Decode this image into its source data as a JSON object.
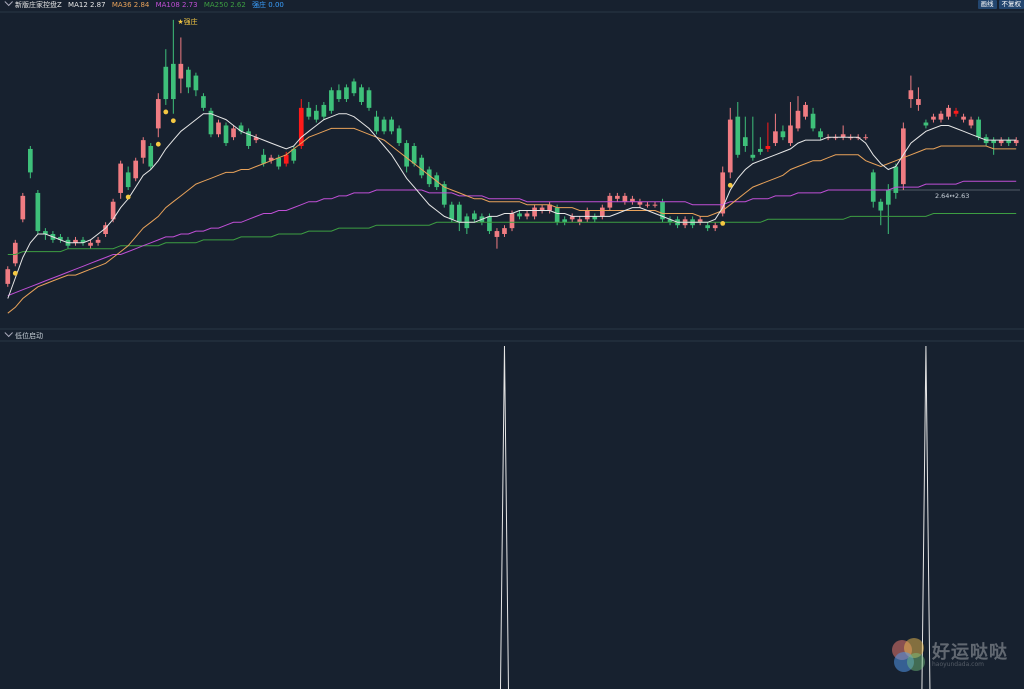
{
  "header": {
    "indicator_name": "新版庄家控盘Z",
    "ma12": "MA12 2.87",
    "ma36": "MA36 2.84",
    "ma108": "MA108 2.73",
    "ma250": "MA250 2.62",
    "strong": "强庄 0.00",
    "btn_draw": "画线",
    "btn_fq": "不复权"
  },
  "sub_panel": {
    "title": "低位启动"
  },
  "watermark": {
    "title": "好运哒哒",
    "sub": "haoyundada.com"
  },
  "colors": {
    "bg": "#17212f",
    "up": "#f07c82",
    "up_big": "#ff1a1a",
    "down": "#3ec07a",
    "ma12": "#e6e6e6",
    "ma36": "#e8a25a",
    "ma108": "#c04fd6",
    "ma250": "#3d9e42",
    "strong": "#3aa0ff"
  },
  "chart_data": {
    "type": "candlestick",
    "ylim": [
      2.25,
      3.3
    ],
    "candles": [
      [
        2.38,
        2.43,
        2.37,
        2.44
      ],
      [
        2.45,
        2.52,
        2.44,
        2.53
      ],
      [
        2.6,
        2.68,
        2.59,
        2.69
      ],
      [
        2.84,
        2.76,
        2.74,
        2.85
      ],
      [
        2.69,
        2.56,
        2.55,
        2.7
      ],
      [
        2.56,
        2.55,
        2.53,
        2.57
      ],
      [
        2.55,
        2.53,
        2.52,
        2.56
      ],
      [
        2.54,
        2.53,
        2.52,
        2.55
      ],
      [
        2.53,
        2.51,
        2.5,
        2.54
      ],
      [
        2.52,
        2.53,
        2.51,
        2.54
      ],
      [
        2.53,
        2.52,
        2.51,
        2.54
      ],
      [
        2.51,
        2.52,
        2.5,
        2.53
      ],
      [
        2.52,
        2.53,
        2.51,
        2.54
      ],
      [
        2.55,
        2.58,
        2.54,
        2.59
      ],
      [
        2.6,
        2.66,
        2.59,
        2.67
      ],
      [
        2.69,
        2.79,
        2.67,
        2.8
      ],
      [
        2.76,
        2.71,
        2.7,
        2.78
      ],
      [
        2.74,
        2.8,
        2.73,
        2.81
      ],
      [
        2.81,
        2.87,
        2.79,
        2.88
      ],
      [
        2.85,
        2.78,
        2.77,
        2.86
      ],
      [
        2.91,
        3.01,
        2.88,
        3.03
      ],
      [
        3.12,
        3.01,
        2.99,
        3.18
      ],
      [
        3.13,
        3.01,
        2.96,
        3.28
      ],
      [
        3.08,
        3.13,
        3.03,
        3.22
      ],
      [
        3.11,
        3.05,
        3.03,
        3.12
      ],
      [
        3.09,
        3.04,
        3.02,
        3.1
      ],
      [
        3.02,
        2.98,
        2.97,
        3.03
      ],
      [
        2.97,
        2.89,
        2.88,
        2.98
      ],
      [
        2.89,
        2.93,
        2.88,
        2.94
      ],
      [
        2.92,
        2.86,
        2.85,
        2.93
      ],
      [
        2.88,
        2.91,
        2.87,
        2.92
      ],
      [
        2.92,
        2.9,
        2.89,
        2.93
      ],
      [
        2.9,
        2.85,
        2.84,
        2.91
      ],
      [
        2.87,
        2.88,
        2.86,
        2.89
      ],
      [
        2.82,
        2.79,
        2.78,
        2.84
      ],
      [
        2.8,
        2.81,
        2.79,
        2.82
      ],
      [
        2.81,
        2.78,
        2.77,
        2.82
      ],
      [
        2.79,
        2.82,
        2.78,
        2.83
      ],
      [
        2.84,
        2.8,
        2.79,
        2.85
      ],
      [
        2.85,
        2.98,
        2.84,
        3.01
      ],
      [
        2.98,
        2.95,
        2.94,
        3.0
      ],
      [
        2.97,
        2.94,
        2.93,
        2.99
      ],
      [
        2.99,
        2.95,
        2.94,
        3.0
      ],
      [
        3.04,
        2.97,
        2.96,
        3.05
      ],
      [
        3.04,
        3.01,
        3.0,
        3.06
      ],
      [
        3.05,
        3.01,
        3.0,
        3.06
      ],
      [
        3.07,
        3.03,
        3.02,
        3.08
      ],
      [
        3.05,
        3.0,
        2.99,
        3.06
      ],
      [
        3.04,
        2.98,
        2.97,
        3.05
      ],
      [
        2.95,
        2.9,
        2.89,
        2.97
      ],
      [
        2.94,
        2.9,
        2.89,
        2.95
      ],
      [
        2.94,
        2.9,
        2.89,
        2.95
      ],
      [
        2.91,
        2.86,
        2.85,
        2.92
      ],
      [
        2.86,
        2.78,
        2.76,
        2.87
      ],
      [
        2.85,
        2.79,
        2.78,
        2.86
      ],
      [
        2.81,
        2.75,
        2.74,
        2.82
      ],
      [
        2.77,
        2.72,
        2.71,
        2.78
      ],
      [
        2.75,
        2.71,
        2.7,
        2.76
      ],
      [
        2.72,
        2.65,
        2.64,
        2.73
      ],
      [
        2.65,
        2.6,
        2.59,
        2.66
      ],
      [
        2.65,
        2.59,
        2.56,
        2.66
      ],
      [
        2.61,
        2.57,
        2.55,
        2.62
      ],
      [
        2.62,
        2.6,
        2.59,
        2.63
      ],
      [
        2.61,
        2.59,
        2.58,
        2.62
      ],
      [
        2.61,
        2.56,
        2.55,
        2.62
      ],
      [
        2.54,
        2.56,
        2.5,
        2.57
      ],
      [
        2.55,
        2.57,
        2.54,
        2.58
      ],
      [
        2.57,
        2.62,
        2.56,
        2.63
      ],
      [
        2.62,
        2.61,
        2.6,
        2.63
      ],
      [
        2.61,
        2.62,
        2.6,
        2.63
      ],
      [
        2.61,
        2.64,
        2.6,
        2.65
      ],
      [
        2.63,
        2.64,
        2.62,
        2.65
      ],
      [
        2.63,
        2.65,
        2.62,
        2.66
      ],
      [
        2.64,
        2.59,
        2.58,
        2.65
      ],
      [
        2.6,
        2.59,
        2.58,
        2.61
      ],
      [
        2.6,
        2.61,
        2.59,
        2.62
      ],
      [
        2.59,
        2.6,
        2.58,
        2.61
      ],
      [
        2.6,
        2.63,
        2.59,
        2.64
      ],
      [
        2.61,
        2.6,
        2.59,
        2.62
      ],
      [
        2.61,
        2.64,
        2.6,
        2.65
      ],
      [
        2.64,
        2.68,
        2.63,
        2.69
      ],
      [
        2.67,
        2.68,
        2.66,
        2.69
      ],
      [
        2.66,
        2.68,
        2.65,
        2.69
      ],
      [
        2.66,
        2.67,
        2.65,
        2.68
      ],
      [
        2.65,
        2.66,
        2.64,
        2.67
      ],
      [
        2.65,
        2.65,
        2.64,
        2.66
      ],
      [
        2.65,
        2.65,
        2.64,
        2.66
      ],
      [
        2.66,
        2.6,
        2.59,
        2.67
      ],
      [
        2.6,
        2.59,
        2.58,
        2.61
      ],
      [
        2.6,
        2.58,
        2.57,
        2.61
      ],
      [
        2.58,
        2.6,
        2.57,
        2.61
      ],
      [
        2.6,
        2.58,
        2.57,
        2.61
      ],
      [
        2.59,
        2.6,
        2.58,
        2.61
      ],
      [
        2.58,
        2.57,
        2.56,
        2.59
      ],
      [
        2.57,
        2.58,
        2.56,
        2.59
      ],
      [
        2.62,
        2.76,
        2.61,
        2.78
      ],
      [
        2.76,
        2.94,
        2.74,
        2.98
      ],
      [
        2.95,
        2.82,
        2.81,
        3.0
      ],
      [
        2.88,
        2.85,
        2.83,
        2.95
      ],
      [
        2.82,
        2.81,
        2.8,
        2.95
      ],
      [
        2.84,
        2.83,
        2.82,
        2.88
      ],
      [
        2.84,
        2.85,
        2.83,
        2.93
      ],
      [
        2.86,
        2.9,
        2.85,
        2.96
      ],
      [
        2.9,
        2.88,
        2.87,
        2.92
      ],
      [
        2.86,
        2.92,
        2.85,
        3.0
      ],
      [
        2.91,
        2.97,
        2.9,
        3.02
      ],
      [
        2.95,
        2.99,
        2.94,
        3.0
      ],
      [
        2.96,
        2.91,
        2.9,
        2.98
      ],
      [
        2.9,
        2.88,
        2.87,
        2.91
      ],
      [
        2.88,
        2.88,
        2.87,
        2.89
      ],
      [
        2.88,
        2.88,
        2.87,
        2.89
      ],
      [
        2.88,
        2.89,
        2.87,
        2.92
      ],
      [
        2.88,
        2.88,
        2.87,
        2.89
      ],
      [
        2.88,
        2.88,
        2.87,
        2.89
      ],
      [
        2.88,
        2.88,
        2.87,
        2.89
      ],
      [
        2.76,
        2.66,
        2.64,
        2.77
      ],
      [
        2.66,
        2.63,
        2.58,
        2.67
      ],
      [
        2.7,
        2.65,
        2.55,
        2.72
      ],
      [
        2.78,
        2.69,
        2.67,
        2.79
      ],
      [
        2.72,
        2.91,
        2.7,
        2.93
      ],
      [
        3.01,
        3.04,
        2.98,
        3.09
      ],
      [
        2.99,
        3.01,
        2.97,
        3.05
      ],
      [
        2.93,
        2.92,
        2.91,
        2.94
      ],
      [
        2.94,
        2.95,
        2.93,
        2.96
      ],
      [
        2.94,
        2.96,
        2.93,
        2.97
      ],
      [
        2.95,
        2.98,
        2.94,
        2.99
      ],
      [
        2.96,
        2.97,
        2.95,
        2.98
      ],
      [
        2.94,
        2.95,
        2.93,
        2.96
      ],
      [
        2.92,
        2.94,
        2.91,
        2.95
      ],
      [
        2.94,
        2.88,
        2.87,
        2.95
      ],
      [
        2.88,
        2.86,
        2.85,
        2.89
      ],
      [
        2.87,
        2.86,
        2.82,
        2.88
      ],
      [
        2.86,
        2.87,
        2.85,
        2.88
      ],
      [
        2.87,
        2.86,
        2.85,
        2.88
      ],
      [
        2.86,
        2.87,
        2.85,
        2.88
      ]
    ],
    "big_red_indices": [
      3,
      37,
      39,
      42,
      101,
      126
    ],
    "ma12": [
      2.33,
      2.4,
      2.47,
      2.52,
      2.55,
      2.55,
      2.54,
      2.53,
      2.52,
      2.52,
      2.52,
      2.53,
      2.55,
      2.57,
      2.6,
      2.64,
      2.67,
      2.71,
      2.75,
      2.77,
      2.8,
      2.84,
      2.87,
      2.9,
      2.92,
      2.94,
      2.96,
      2.96,
      2.95,
      2.94,
      2.92,
      2.9,
      2.89,
      2.88,
      2.87,
      2.86,
      2.85,
      2.84,
      2.85,
      2.88,
      2.9,
      2.92,
      2.94,
      2.95,
      2.96,
      2.96,
      2.95,
      2.93,
      2.91,
      2.88,
      2.85,
      2.82,
      2.78,
      2.74,
      2.71,
      2.68,
      2.65,
      2.63,
      2.61,
      2.6,
      2.59,
      2.59,
      2.59,
      2.6,
      2.61,
      2.61,
      2.62,
      2.62,
      2.63,
      2.63,
      2.63,
      2.63,
      2.63,
      2.62,
      2.62,
      2.61,
      2.61,
      2.61,
      2.61,
      2.61,
      2.61,
      2.62,
      2.63,
      2.64,
      2.64,
      2.63,
      2.62,
      2.61,
      2.6,
      2.59,
      2.59,
      2.59,
      2.59,
      2.59,
      2.6,
      2.64,
      2.7,
      2.74,
      2.77,
      2.79,
      2.8,
      2.81,
      2.82,
      2.83,
      2.84,
      2.86,
      2.87,
      2.87,
      2.87,
      2.88,
      2.88,
      2.88,
      2.88,
      2.88,
      2.86,
      2.82,
      2.79,
      2.77,
      2.78,
      2.82,
      2.86,
      2.88,
      2.9,
      2.91,
      2.92,
      2.92,
      2.91,
      2.9,
      2.89,
      2.88,
      2.87,
      2.87,
      2.87,
      2.87,
      2.87
    ],
    "ma36": [
      2.28,
      2.3,
      2.33,
      2.35,
      2.37,
      2.38,
      2.39,
      2.4,
      2.41,
      2.41,
      2.42,
      2.43,
      2.44,
      2.45,
      2.47,
      2.49,
      2.51,
      2.54,
      2.57,
      2.59,
      2.61,
      2.64,
      2.66,
      2.68,
      2.7,
      2.72,
      2.73,
      2.74,
      2.75,
      2.76,
      2.76,
      2.77,
      2.77,
      2.78,
      2.79,
      2.8,
      2.81,
      2.82,
      2.84,
      2.86,
      2.88,
      2.89,
      2.9,
      2.91,
      2.91,
      2.91,
      2.91,
      2.9,
      2.89,
      2.88,
      2.87,
      2.85,
      2.83,
      2.81,
      2.79,
      2.77,
      2.75,
      2.73,
      2.71,
      2.7,
      2.69,
      2.68,
      2.67,
      2.67,
      2.66,
      2.66,
      2.66,
      2.66,
      2.66,
      2.65,
      2.65,
      2.65,
      2.65,
      2.64,
      2.64,
      2.64,
      2.63,
      2.63,
      2.63,
      2.63,
      2.63,
      2.63,
      2.63,
      2.63,
      2.63,
      2.63,
      2.63,
      2.62,
      2.62,
      2.62,
      2.62,
      2.62,
      2.61,
      2.61,
      2.62,
      2.63,
      2.65,
      2.67,
      2.69,
      2.71,
      2.72,
      2.73,
      2.74,
      2.75,
      2.77,
      2.78,
      2.79,
      2.8,
      2.8,
      2.81,
      2.82,
      2.82,
      2.82,
      2.82,
      2.8,
      2.79,
      2.78,
      2.79,
      2.8,
      2.81,
      2.82,
      2.83,
      2.84,
      2.84,
      2.85,
      2.85,
      2.85,
      2.85,
      2.85,
      2.85,
      2.85,
      2.84,
      2.84,
      2.84,
      2.84
    ],
    "ma108": [
      2.34,
      2.35,
      2.36,
      2.37,
      2.38,
      2.39,
      2.4,
      2.41,
      2.42,
      2.43,
      2.44,
      2.45,
      2.46,
      2.47,
      2.48,
      2.48,
      2.49,
      2.5,
      2.51,
      2.52,
      2.53,
      2.54,
      2.54,
      2.55,
      2.55,
      2.56,
      2.56,
      2.57,
      2.57,
      2.58,
      2.59,
      2.59,
      2.6,
      2.61,
      2.62,
      2.62,
      2.63,
      2.63,
      2.64,
      2.65,
      2.66,
      2.66,
      2.67,
      2.67,
      2.68,
      2.68,
      2.69,
      2.69,
      2.69,
      2.7,
      2.7,
      2.7,
      2.7,
      2.7,
      2.7,
      2.7,
      2.69,
      2.69,
      2.69,
      2.69,
      2.68,
      2.68,
      2.68,
      2.68,
      2.67,
      2.67,
      2.67,
      2.67,
      2.67,
      2.66,
      2.66,
      2.66,
      2.66,
      2.66,
      2.66,
      2.66,
      2.66,
      2.66,
      2.66,
      2.66,
      2.66,
      2.66,
      2.66,
      2.66,
      2.66,
      2.66,
      2.66,
      2.66,
      2.66,
      2.66,
      2.66,
      2.65,
      2.65,
      2.65,
      2.65,
      2.65,
      2.66,
      2.66,
      2.66,
      2.67,
      2.67,
      2.67,
      2.68,
      2.68,
      2.68,
      2.69,
      2.69,
      2.69,
      2.69,
      2.7,
      2.7,
      2.7,
      2.7,
      2.7,
      2.7,
      2.7,
      2.7,
      2.7,
      2.71,
      2.71,
      2.71,
      2.71,
      2.72,
      2.72,
      2.72,
      2.72,
      2.72,
      2.73,
      2.73,
      2.73,
      2.73,
      2.73,
      2.73,
      2.73,
      2.73
    ],
    "ma250": [
      2.48,
      2.48,
      2.49,
      2.49,
      2.49,
      2.49,
      2.49,
      2.49,
      2.5,
      2.5,
      2.5,
      2.5,
      2.5,
      2.5,
      2.5,
      2.51,
      2.51,
      2.51,
      2.51,
      2.51,
      2.51,
      2.52,
      2.52,
      2.52,
      2.52,
      2.52,
      2.53,
      2.53,
      2.53,
      2.53,
      2.53,
      2.54,
      2.54,
      2.54,
      2.54,
      2.54,
      2.55,
      2.55,
      2.55,
      2.55,
      2.56,
      2.56,
      2.56,
      2.56,
      2.57,
      2.57,
      2.57,
      2.57,
      2.57,
      2.58,
      2.58,
      2.58,
      2.58,
      2.58,
      2.58,
      2.58,
      2.58,
      2.59,
      2.59,
      2.59,
      2.59,
      2.59,
      2.59,
      2.59,
      2.59,
      2.59,
      2.59,
      2.59,
      2.59,
      2.59,
      2.59,
      2.59,
      2.59,
      2.59,
      2.59,
      2.59,
      2.59,
      2.59,
      2.59,
      2.59,
      2.59,
      2.59,
      2.59,
      2.59,
      2.59,
      2.59,
      2.59,
      2.59,
      2.59,
      2.59,
      2.59,
      2.59,
      2.59,
      2.59,
      2.59,
      2.59,
      2.59,
      2.59,
      2.59,
      2.59,
      2.59,
      2.6,
      2.6,
      2.6,
      2.6,
      2.6,
      2.6,
      2.6,
      2.6,
      2.6,
      2.6,
      2.6,
      2.61,
      2.61,
      2.61,
      2.61,
      2.61,
      2.61,
      2.61,
      2.61,
      2.61,
      2.61,
      2.61,
      2.62,
      2.62,
      2.62,
      2.62,
      2.62,
      2.62,
      2.62,
      2.62,
      2.62,
      2.62,
      2.62,
      2.62
    ],
    "markers": [
      {
        "index": 1,
        "label": ""
      },
      {
        "index": 20,
        "label": ""
      },
      {
        "index": 21,
        "label": ""
      },
      {
        "index": 22,
        "label": "强庄"
      },
      {
        "index": 16,
        "label": ""
      },
      {
        "index": 96,
        "label": ""
      },
      {
        "index": 95,
        "label": ""
      }
    ],
    "annotation": {
      "index": 124,
      "text": "2.64↔2.63"
    },
    "hline_value": 2.7,
    "sub_series": {
      "spikes_at": [
        66,
        122
      ],
      "range": [
        0,
        1
      ]
    }
  }
}
